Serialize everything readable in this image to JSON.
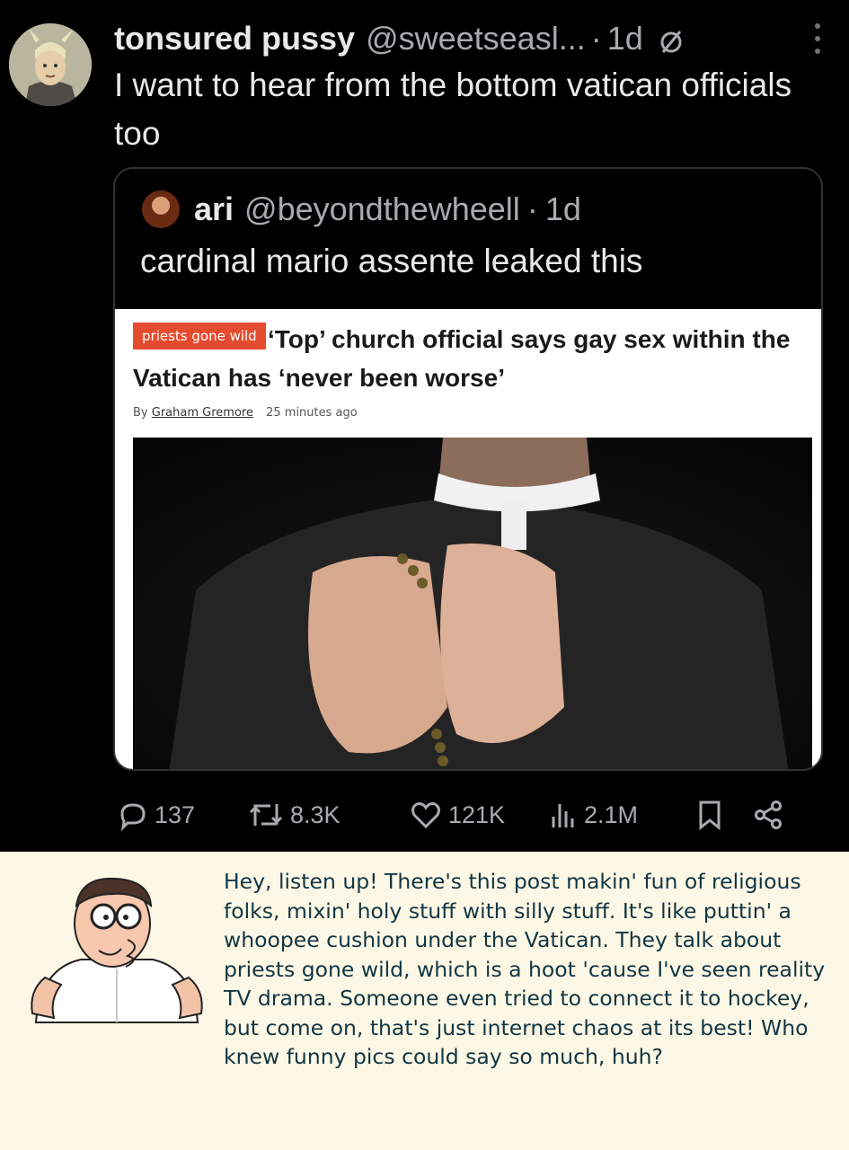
{
  "tweet": {
    "display_name": "tonsured pussy",
    "handle": "@sweetseasl...",
    "separator": "·",
    "time": "1d",
    "text": "I want to hear from the bottom vatican officials too"
  },
  "quote": {
    "display_name": "ari",
    "handle": "@beyondthewheell",
    "separator": "·",
    "time": "1d",
    "text": "cardinal mario assente leaked this",
    "article": {
      "tag": "priests gone wild",
      "headline": "‘Top’ church official says gay sex within the Vatican has ‘never been worse’",
      "byline_prefix": "By",
      "author": "Graham Gremore",
      "time": "25 minutes ago"
    }
  },
  "actions": {
    "replies": "137",
    "reposts": "8.3K",
    "likes": "121K",
    "views": "2.1M"
  },
  "caption": {
    "text": "Hey, listen up! There's this post makin' fun of religious folks, mixin' holy stuff with silly stuff. It's like puttin' a whoopee cushion under the Vatican. They talk about priests gone wild, which is a hoot 'cause I've seen reality TV drama. Someone even tried to connect it to hockey, but come on, that's just internet chaos at its best! Who knew funny pics could say so much, huh?"
  },
  "icons": {
    "ghost": "no-symbol-icon",
    "more": "more-options-icon",
    "reply": "reply-icon",
    "repost": "repost-icon",
    "like": "heart-icon",
    "views": "views-icon",
    "bookmark": "bookmark-icon",
    "share": "share-icon"
  },
  "colors": {
    "background": "#000000",
    "text": "#e7e9ea",
    "muted": "#a7abaf",
    "tag": "#e54b2f",
    "caption_bg": "#fdf7e6",
    "caption_text": "#123642"
  }
}
